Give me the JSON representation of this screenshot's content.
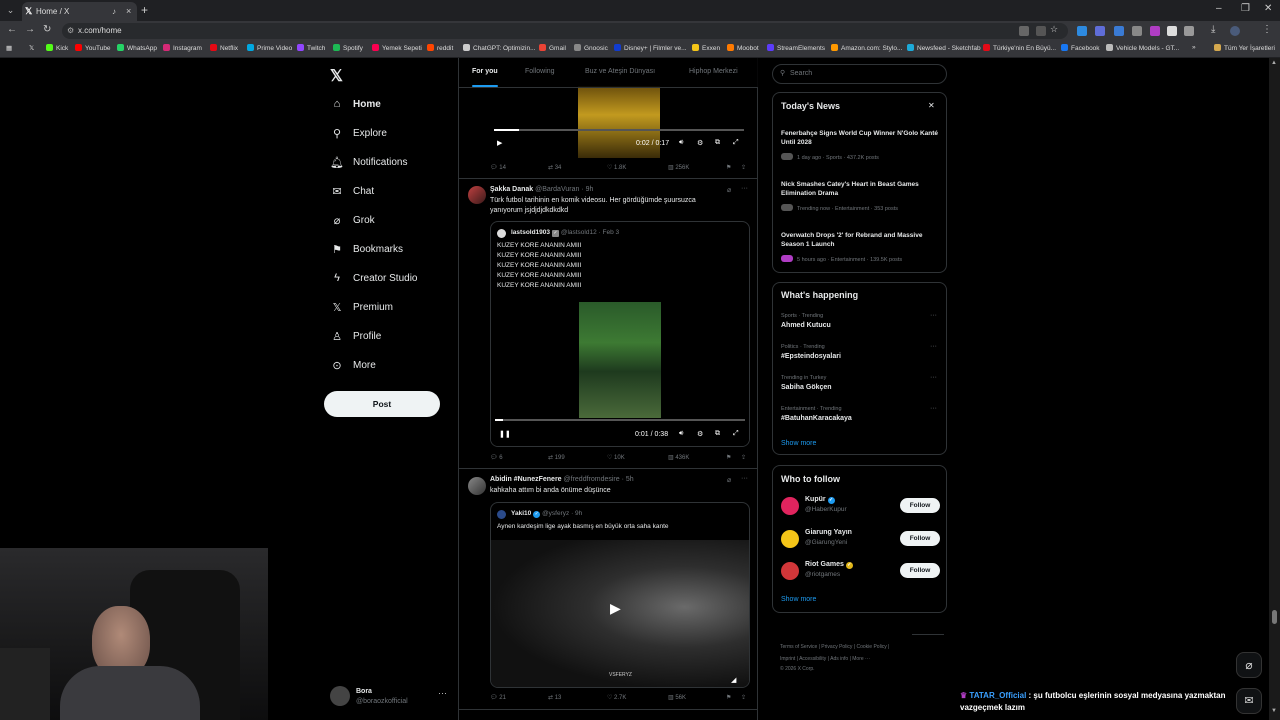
{
  "browser": {
    "tab_title": "Home / X",
    "url": "x.com/home",
    "bookmarks": [
      "Kick",
      "YouTube",
      "WhatsApp",
      "Instagram",
      "Netflix",
      "Prime Video",
      "Twitch",
      "Spotify",
      "Yemek Sepeti",
      "reddit",
      "ChatGPT: Optimizin...",
      "Gmail",
      "Gnoosic",
      "Disney+ | Filmler ve...",
      "Exxen",
      "Moobot",
      "StreamElements",
      "Amazon.com: Stylo...",
      "Newsfeed - Sketchfab",
      "Türkiye'nin En Büyü...",
      "Facebook",
      "Vehicle Models - GT...",
      "Tüm Yer İşaretleri"
    ]
  },
  "nav": {
    "items": [
      "Home",
      "Explore",
      "Notifications",
      "Chat",
      "Grok",
      "Bookmarks",
      "Creator Studio",
      "Premium",
      "Profile",
      "More"
    ],
    "post_label": "Post",
    "account_name": "Bora",
    "account_handle": "@boraozkofficial"
  },
  "timeline": {
    "tabs": [
      "For you",
      "Following",
      "Buz ve Ateşin Dünyası",
      "Hiphop Merkezi"
    ],
    "tweet0": {
      "video_time": "0:02 / 0:17",
      "replies": "14",
      "reposts": "34",
      "likes": "1.8K",
      "views": "256K"
    },
    "tweet1": {
      "name": "Şakka Danak",
      "handle": "@BardaVuran",
      "time": "· 9h",
      "text": "Türk futbol tarihinin en komik videosu. Her gördüğümde şuursuzca yanıyorum jsjdjdjdkdkdkd",
      "quote_name": "lastsold1903",
      "quote_handle": "@lastsold12",
      "quote_time": "· Feb 3",
      "quote_lines": [
        "KUZEY KORE ANANIN AMIII",
        "KUZEY KORE ANANIN AMIII",
        "KUZEY KORE ANANIN AMIII",
        "KUZEY KORE ANANIN AMIII",
        "KUZEY KORE ANANIN AMIII"
      ],
      "video_time": "0:01 / 0:38",
      "video_progress": 0.03,
      "replies": "6",
      "reposts": "199",
      "likes": "10K",
      "views": "436K"
    },
    "tweet2": {
      "name": "Abidin #NunezFenere",
      "handle": "@freddfromdesire",
      "time": "· 5h",
      "text": "kahkaha attım bi anda önüme düşünce",
      "quote_name": "Yaki10",
      "quote_handle": "@ysferyz",
      "quote_time": "· 9h",
      "quote_text": "Aynen kardeşim lige ayak basmış en büyük orta saha kante",
      "watermark": "VSFERYZ",
      "replies": "21",
      "reposts": "13",
      "likes": "2.7K",
      "views": "56K"
    }
  },
  "right": {
    "search_placeholder": "Search",
    "news_title": "Today's News",
    "news": [
      {
        "headline": "Fenerbahçe Signs World Cup Winner N'Golo Kanté Until 2028",
        "meta": "1 day ago · Sports · 437.2K posts"
      },
      {
        "headline": "Nick Smashes Catey's Heart in Beast Games Elimination Drama",
        "meta": "Trending now · Entertainment · 353 posts"
      },
      {
        "headline": "Overwatch Drops '2' for Rebrand and Massive Season 1 Launch",
        "meta": "5 hours ago · Entertainment · 139.5K posts"
      }
    ],
    "happening_title": "What's happening",
    "trends": [
      {
        "category": "Sports · Trending",
        "name": "Ahmed Kutucu"
      },
      {
        "category": "Politics · Trending",
        "name": "#Epsteindosyalari"
      },
      {
        "category": "Trending in Turkey",
        "name": "Sabiha Gökçen"
      },
      {
        "category": "Entertainment · Trending",
        "name": "#BatuhanKaracakaya"
      }
    ],
    "show_more": "Show more",
    "wtf_title": "Who to follow",
    "follow": [
      {
        "name": "Kupür",
        "handle": "@HaberKupur",
        "color": "#e0245e"
      },
      {
        "name": "Giarung Yayın",
        "handle": "@GiarungYeni",
        "color": "#f5c518"
      },
      {
        "name": "Riot Games",
        "handle": "@riotgames",
        "color": "#d13639"
      }
    ],
    "follow_label": "Follow",
    "footer_line1": "Terms of Service  |  Privacy Policy  |  Cookie Policy  |",
    "footer_line2": "Imprint  |  Accessibility  |  Ads info  |  More ···",
    "footer_line3": "© 2026 X Corp."
  },
  "chat_overlay": {
    "user": "TATAR_Official",
    "message": ": şu futbolcu eşlerinin sosyal medyasına yazmaktan vazgeçmek lazım"
  },
  "colors": {
    "accent": "#1d9bf0",
    "bg": "#000000",
    "border": "#2f3336"
  }
}
